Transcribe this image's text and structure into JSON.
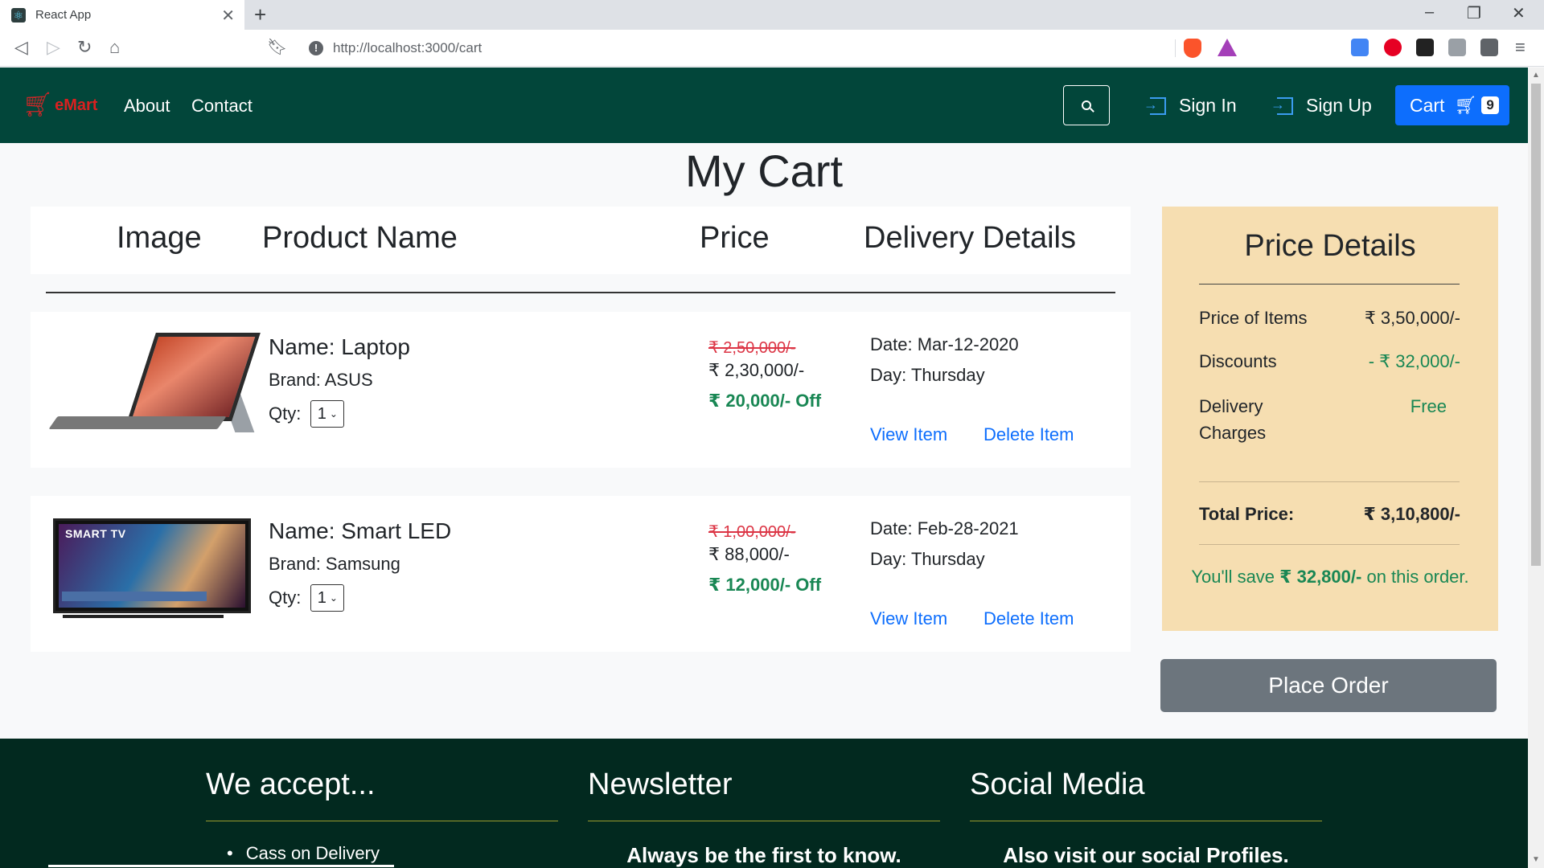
{
  "browser": {
    "tab_title": "React App",
    "tab_close": "✕",
    "new_tab": "+",
    "url": "http://localhost:3000/cart",
    "min_glyph": "–",
    "max_glyph": "❐",
    "close_glyph": "✕",
    "menu_glyph": "≡"
  },
  "navbar": {
    "brand": "eMart",
    "links": [
      "About",
      "Contact"
    ],
    "sign_in": "Sign In",
    "sign_up": "Sign Up",
    "cart_label": "Cart",
    "cart_count": "9"
  },
  "page": {
    "title": "My Cart"
  },
  "table": {
    "headers": [
      "Image",
      "Product Name",
      "Price",
      "Delivery Details"
    ]
  },
  "items": [
    {
      "name": "Name: Laptop",
      "brand": "Brand: ASUS",
      "qty_label": "Qty:",
      "qty": "1",
      "old_price": "₹ 2,50,000/-",
      "new_price": "₹ 2,30,000/-",
      "off": "₹ 20,000/- Off",
      "date": "Date: Mar-12-2020",
      "day": "Day: Thursday",
      "view": "View Item",
      "delete": "Delete Item"
    },
    {
      "name": "Name: Smart LED",
      "brand": "Brand: Samsung",
      "qty_label": "Qty:",
      "qty": "1",
      "old_price": "₹ 1,00,000/-",
      "new_price": "₹ 88,000/-",
      "off": "₹ 12,000/- Off",
      "date": "Date: Feb-28-2021",
      "day": "Day: Thursday",
      "view": "View Item",
      "delete": "Delete Item",
      "image_label": "SMART TV"
    }
  ],
  "price_details": {
    "title": "Price Details",
    "price_label": "Price of Items",
    "price_value": "₹ 3,50,000/-",
    "discount_label": "Discounts",
    "discount_value": "- ₹ 32,000/-",
    "delivery_label_1": "Delivery",
    "delivery_label_2": "Charges",
    "delivery_value": "Free",
    "total_label": "Total Price:",
    "total_value": "₹ 3,10,800/-",
    "save_prefix": "You'll save",
    "save_amount": "₹ 32,800/-",
    "save_suffix": "on this order."
  },
  "place_order": "Place Order",
  "footer": {
    "col1_title": "We accept...",
    "col1_item": "Cass on Delivery",
    "col2_title": "Newsletter",
    "col2_sub": "Always be the first to know.",
    "col3_title": "Social Media",
    "col3_sub": "Also visit our social Profiles."
  },
  "colors": {
    "navbar": "#02463a",
    "footer": "#02291f",
    "accent": "#0d6efd",
    "discount_green": "#198754",
    "old_price_red": "#dc3545",
    "price_box": "#f6deb1",
    "place_order": "#6c757d"
  },
  "icons": [
    "react-icon",
    "back-icon",
    "forward-icon",
    "reload-icon",
    "home-icon",
    "bookmark-icon",
    "info-icon",
    "brave-shield-icon",
    "brave-rewards-icon",
    "translate-icon",
    "pinterest-icon",
    "extension-icon",
    "puzzle-icon",
    "cart-icon",
    "search-icon",
    "login-icon"
  ]
}
